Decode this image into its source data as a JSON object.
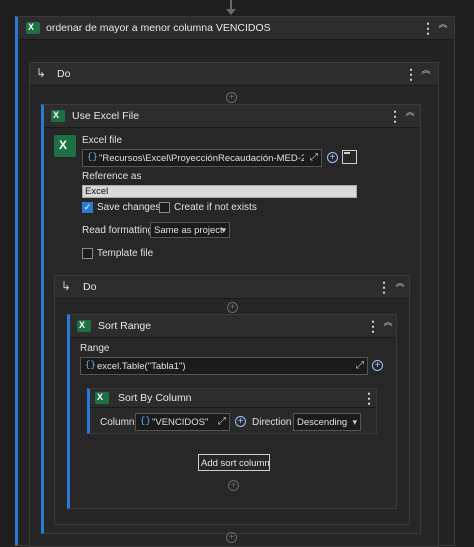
{
  "top_action": {
    "title": "ordenar de mayor a menor columna VENCIDOS"
  },
  "do_outer": {
    "label": "Do"
  },
  "use_excel": {
    "title": "Use Excel File",
    "excel_file_label": "Excel file",
    "excel_file_value": "\"Recursos\\Excel\\ProyecciónRecaudación-MED-26-",
    "reference_label": "Reference as",
    "reference_value": "Excel",
    "save_changes_label": "Save changes",
    "create_if_not_exists_label": "Create if not exists",
    "read_formatting_label": "Read formatting",
    "read_formatting_value": "Same as project",
    "template_file_label": "Template file",
    "brace": "{}"
  },
  "do_inner": {
    "label": "Do"
  },
  "sort_range": {
    "title": "Sort Range",
    "range_label": "Range",
    "range_value": "excel.Table(\"Tabla1\")",
    "brace": "{}"
  },
  "sort_by_column": {
    "title": "Sort By Column",
    "column_label": "Column",
    "column_value": "\"VENCIDOS\"",
    "direction_label": "Direction",
    "direction_value": "Descending",
    "brace": "{}"
  },
  "add_sort_column_label": "Add sort column",
  "icons": {
    "kebab": "⋮",
    "collapse": "︽",
    "plus": "+",
    "expand": "⤢",
    "check": "✓",
    "chevron": "▾",
    "branch": "↳"
  }
}
